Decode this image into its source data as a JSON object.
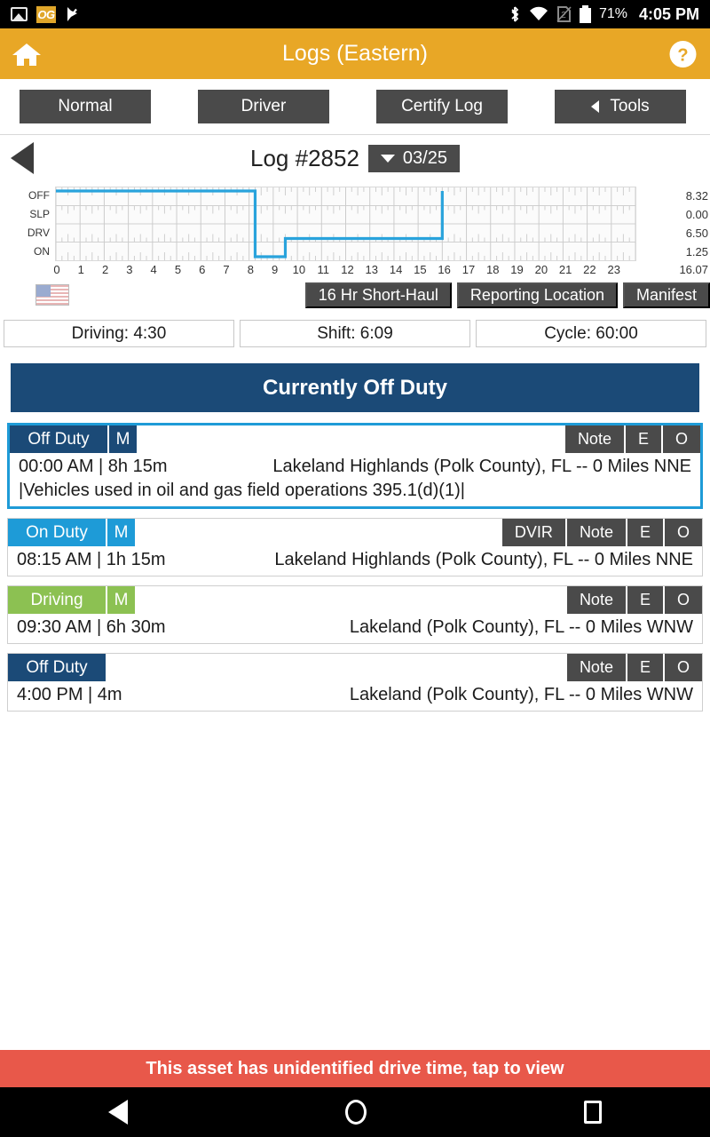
{
  "statusbar": {
    "icons_left": [
      "photo-icon",
      "og-app-icon",
      "flag-check-icon"
    ],
    "og_label": "OG",
    "icons_right": [
      "bluetooth-icon",
      "wifi-icon",
      "sim-icon",
      "battery-icon"
    ],
    "battery_percent": "71%",
    "time": "4:05 PM"
  },
  "appbar": {
    "title": "Logs (Eastern)",
    "home_icon": "home-icon",
    "help_icon": "help-icon",
    "bg_color": "#e8a726"
  },
  "tabs": [
    {
      "label": "Normal",
      "icon": ""
    },
    {
      "label": "Driver",
      "icon": ""
    },
    {
      "label": "Certify Log",
      "icon": ""
    },
    {
      "label": "Tools",
      "icon": "triangle-left-icon"
    }
  ],
  "log_header": {
    "back_icon": "back-arrow-icon",
    "title": "Log #2852",
    "date": "03/25",
    "caret_icon": "chevron-down-icon"
  },
  "chart_data": {
    "type": "line",
    "title": "Log #2852 Duty Status Graph",
    "xlabel": "",
    "ylabel": "",
    "xlim": [
      0,
      24
    ],
    "ylim": [
      0,
      4
    ],
    "grid": true,
    "legend": "none",
    "row_labels": [
      "OFF",
      "SLP",
      "DRV",
      "ON"
    ],
    "row_totals": [
      "8.32",
      "0.00",
      "6.50",
      "1.25"
    ],
    "grand_total": "16.07",
    "x_ticks": [
      0,
      1,
      2,
      3,
      4,
      5,
      6,
      7,
      8,
      9,
      10,
      11,
      12,
      13,
      14,
      15,
      16,
      17,
      18,
      19,
      20,
      21,
      22,
      23
    ],
    "x_tick_labels": [
      "0",
      "1",
      "2",
      "3",
      "4",
      "5",
      "6",
      "7",
      "8",
      "9",
      "10",
      "11",
      "12",
      "13",
      "14",
      "15",
      "16",
      "17",
      "18",
      "19",
      "20",
      "21",
      "22",
      "23"
    ],
    "line_color": "#29a3dc",
    "segments": [
      {
        "status": "OFF",
        "start_hour": 0.0,
        "end_hour": 8.25
      },
      {
        "status": "ON",
        "start_hour": 8.25,
        "end_hour": 9.5
      },
      {
        "status": "DRV",
        "start_hour": 9.5,
        "end_hour": 16.0
      },
      {
        "status": "OFF",
        "start_hour": 16.0,
        "end_hour": 16.0
      }
    ]
  },
  "mid_buttons": [
    {
      "label": "16 Hr Short-Haul"
    },
    {
      "label": "Reporting Location"
    },
    {
      "label": "Manifest"
    }
  ],
  "flag_icon": "us-flag-icon",
  "clocks": [
    {
      "label": "Driving: 4:30"
    },
    {
      "label": "Shift: 6:09"
    },
    {
      "label": "Cycle: 60:00"
    }
  ],
  "status_banner": {
    "text": "Currently Off Duty",
    "color": "#1b4a77"
  },
  "entries": [
    {
      "status": "Off Duty",
      "status_class": "offduty",
      "has_m": true,
      "m_label": "M",
      "selected": true,
      "actions": [
        "Note",
        "E",
        "O"
      ],
      "time": "00:00 AM | 8h 15m",
      "location": "Lakeland Highlands (Polk County), FL -- 0 Miles NNE",
      "note": "|Vehicles used in oil and gas field operations 395.1(d)(1)|"
    },
    {
      "status": "On Duty",
      "status_class": "onduty",
      "has_m": true,
      "m_label": "M",
      "selected": false,
      "actions": [
        "DVIR",
        "Note",
        "E",
        "O"
      ],
      "time": "08:15 AM | 1h 15m",
      "location": "Lakeland Highlands (Polk County), FL -- 0 Miles NNE",
      "note": ""
    },
    {
      "status": "Driving",
      "status_class": "driving",
      "has_m": true,
      "m_label": "M",
      "selected": false,
      "actions": [
        "Note",
        "E",
        "O"
      ],
      "time": "09:30 AM | 6h 30m",
      "location": "Lakeland (Polk County), FL -- 0 Miles WNW",
      "note": ""
    },
    {
      "status": "Off Duty",
      "status_class": "offduty",
      "has_m": false,
      "m_label": "",
      "selected": false,
      "actions": [
        "Note",
        "E",
        "O"
      ],
      "time": "4:00 PM | 4m",
      "location": "Lakeland (Polk County), FL -- 0 Miles WNW",
      "note": ""
    }
  ],
  "warning_bar": {
    "text": "This asset has unidentified drive time, tap to view",
    "color": "#e8584a"
  },
  "navbar": {
    "back_icon": "nav-back-icon",
    "home_icon": "nav-home-icon",
    "recent_icon": "nav-recent-icon"
  }
}
